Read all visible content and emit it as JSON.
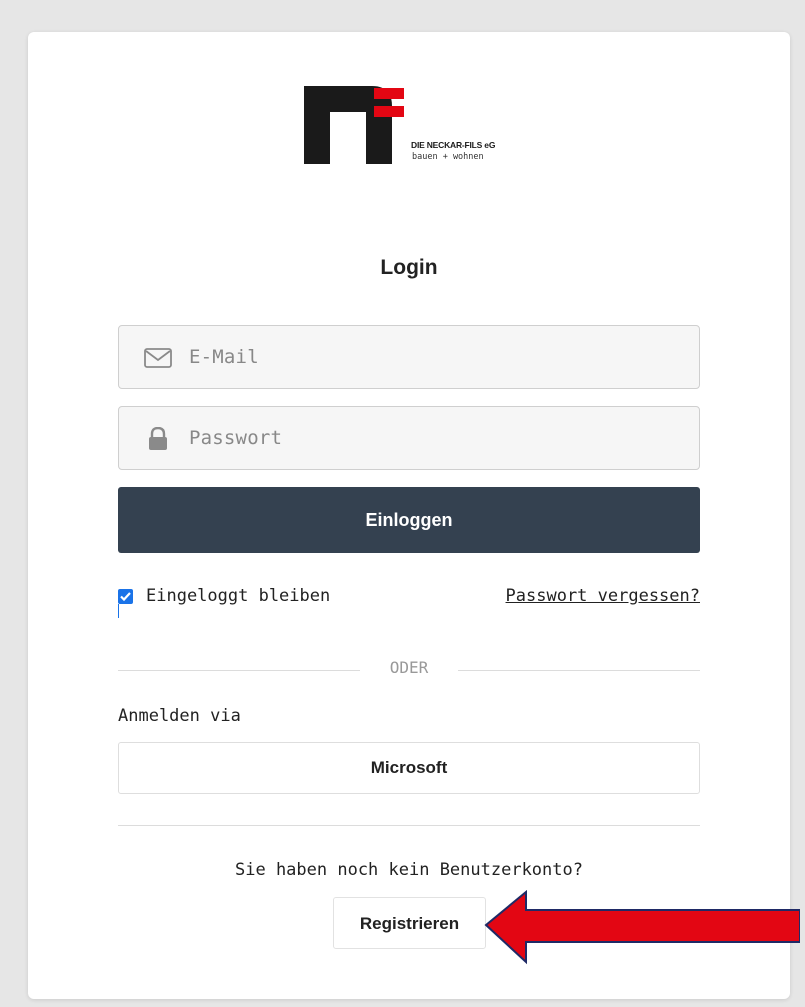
{
  "brand": {
    "name": "DIE NECKAR-FILS eG",
    "tagline": "bauen + wohnen",
    "colors": {
      "dark": "#1a1a1a",
      "accent": "#e30613"
    }
  },
  "login": {
    "title": "Login",
    "email_placeholder": "E-Mail",
    "email_icon": "envelope-icon",
    "password_placeholder": "Passwort",
    "password_icon": "lock-icon",
    "submit_label": "Einloggen",
    "submit_color": "#344150",
    "remember_label": "Eingeloggt bleiben",
    "remember_checked": true,
    "forgot_label": "Passwort vergessen?"
  },
  "alt_login": {
    "divider_label": "ODER",
    "via_label": "Anmelden via",
    "provider_label": "Microsoft"
  },
  "register": {
    "prompt": "Sie haben noch kein Benutzerkonto?",
    "button_label": "Registrieren"
  },
  "annotation": {
    "arrow_color": "#e30613",
    "arrow_icon": "red-arrow-pointing-left"
  }
}
